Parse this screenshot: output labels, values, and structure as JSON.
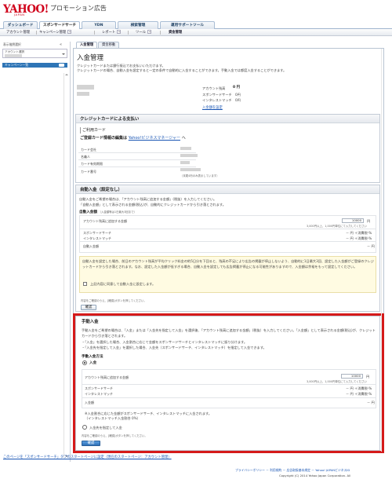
{
  "header": {
    "logo_text": "YAHOO!",
    "logo_sub": "JAPAN",
    "app_title": "プロモーション広告"
  },
  "tabs": [
    {
      "label": "ダッシュボード",
      "active": false
    },
    {
      "label": "スポンサードサーチ",
      "active": true
    },
    {
      "label": "YDN",
      "active": false
    },
    {
      "label": "検索管理",
      "active": false
    },
    {
      "label": "運用サポートツール",
      "active": false
    }
  ],
  "subnav": {
    "account": "アカウント管理",
    "campaign": "キャンペーン管理",
    "report": "レポート",
    "tools": "ツール",
    "funds": "資金管理"
  },
  "sidebar": {
    "title": "表示階層選択",
    "collapse": "«",
    "account_label": "アカウント選択",
    "item": "キャンペーン一覧"
  },
  "subtabs": [
    "入金管理",
    "資金移動"
  ],
  "page": {
    "title": "入金管理",
    "intro_1": "クレジットカードまたは銀行振込でお支払いいただけます。",
    "intro_2": "クレジットカードの場合、自動入金を設定すると一定の条件で自動的に入金することができます。手動入金では都度入金することができます。",
    "balance_label": "アカウント残高",
    "balance_value": "0 円",
    "ss_label": "スポンサードサーチ",
    "ss_value": "0円",
    "im_label": "インタレストマッチ",
    "im_value": "0円",
    "settings_link": "入金額を設定"
  },
  "credit": {
    "heading": "クレジットカードによる支払い",
    "used_card": "ご利用カード",
    "change_note_prefix": "ご登録カード情報の編集は",
    "change_note_link": "Yahoo!ビジネスマネージャー",
    "change_note_suffix": "へ",
    "fields": [
      "カード会社",
      "名義人",
      "カード有効期限",
      "カード番号"
    ],
    "card_note": "（末尾4桁のみ表示しています）"
  },
  "auto": {
    "heading": "自動入金（設定なし）",
    "desc_1": "自動入金をご希望の場合は、「アカウント残高に追加する金額」(税抜）を入力してください。",
    "desc_2": "「自動入金額」として表示される金額(税込)が、自動的にクレジットカードから引き落とされます。",
    "amount_title": "自動入金額",
    "amount_hint": "（入金額等は1日最大3回まで）",
    "add_label": "アカウント残高に追加する金額",
    "add_value": "10000",
    "yen": "円",
    "add_small": "3,000円以上、1,000円単位にて入力してください",
    "ss_label": "スポンサードサーチ",
    "im_label": "インタレストマッチ",
    "tax_value": "－ 円 ＋消費税-%",
    "total_label": "自動入金額",
    "total_value": "－ 円",
    "warn": "自動入金を設定した場合、前日のアカウント残高が平均クリック料金の約5日分を下回ると、残高の不足により広告の掲載が停止しないよう、自動的に1日最大3回、設定した入金額がご登録のクレジットカードから引き落とされます。なお、設定した入金額が低すぎる場合、自動入金を設定しても広告掲載が停止になる可能性がありますので、入金額は余裕をもって設定してください。",
    "agree": "上記内容に同意して自動入金に設定します。",
    "confirm_note": "内容をご確認のうえ、[確認]ボタンを押してください。",
    "confirm_btn": "確認"
  },
  "manual": {
    "heading": "手動入金",
    "desc_1": "手動入金をご希望の場合は、「入金」または「入金先を指定して入金」を選択後、「アカウント残高に追加する金額」(税抜）を入力してください。「入金額」として表示される金額(税込)が、クレジットカードから引き落とされます。",
    "desc_2": "・「入金」を選択した場合、入金割合に応じて金額をスポンサードサーチとインタレストマッチに振り分けます。",
    "desc_3": "・「入金先を指定して入金」を選択した場合、入金先（スポンサードサーチ、インタレストマッチ）を指定して入金できます。",
    "method_title": "手動入金方法",
    "opt_1": "入金",
    "add_label": "アカウント残高に追加する金額",
    "add_value": "10000",
    "yen": "円",
    "add_small": "3,000円以上、1,000円単位にて入力してください",
    "ss_label": "スポンサードサーチ",
    "im_label": "インタレストマッチ",
    "tax_value": "－ 円 ＋消費税-%",
    "total_label": "入金額",
    "total_value": "－ 円",
    "note_1": "※入金割合に応じた金額がスポンサードサーチ、インタレストマッチに入金されます。",
    "note_2": "（インタレストマッチ入金割合 0%）",
    "opt_2": "入金先を指定して入金",
    "confirm_note": "内容をご確認のうえ、[確認]ボタンを押してください。",
    "confirm_btn": "確認"
  },
  "footer": {
    "note": "このページを「スポンサードサーチ」タブのスタートページに設定（現在のスタートページ：アカウント管理）",
    "links": "プライバシーポリシー － 利用規約 － 広告取扱基本規定 － Yahoo! JAPANビジネスID",
    "copyright": "Copyright (C) 2014 Yahoo Japan Corporation. All"
  },
  "colors": {
    "brand": "#d0021b",
    "link": "#1a56b4",
    "highlight_frame": "#d51a1a",
    "primary_button": "#2d6fb6"
  }
}
